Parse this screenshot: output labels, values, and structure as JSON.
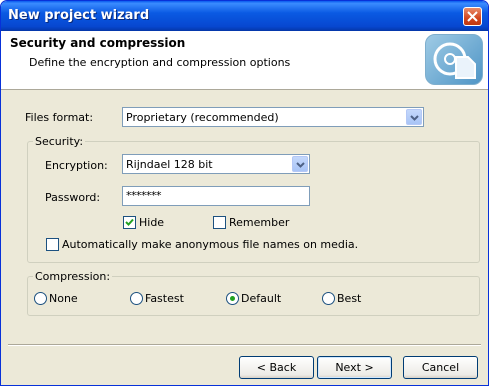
{
  "window": {
    "title": "New project wizard"
  },
  "header": {
    "title": "Security and compression",
    "subtitle": "Define the encryption and compression options",
    "icon": "disc-document-icon"
  },
  "files_format": {
    "label": "Files format:",
    "value": "Proprietary (recommended)"
  },
  "security": {
    "group_label": "Security:",
    "encryption": {
      "label": "Encryption:",
      "value": "Rijndael 128 bit"
    },
    "password": {
      "label": "Password:",
      "value": "*******"
    },
    "hide": {
      "label": "Hide",
      "checked": true
    },
    "remember": {
      "label": "Remember",
      "checked": false
    },
    "anonymous": {
      "label": "Automatically make anonymous file names on media.",
      "checked": false
    }
  },
  "compression": {
    "group_label": "Compression:",
    "options": [
      {
        "label": "None",
        "selected": false
      },
      {
        "label": "Fastest",
        "selected": false
      },
      {
        "label": "Default",
        "selected": true
      },
      {
        "label": "Best",
        "selected": false
      }
    ]
  },
  "buttons": {
    "back": "< Back",
    "next": "Next >",
    "cancel": "Cancel"
  },
  "colors": {
    "title_bar": "#0a5ae3",
    "dialog_bg": "#ece9d8",
    "radio_dot": "#21a121",
    "check_mark": "#21a121"
  }
}
